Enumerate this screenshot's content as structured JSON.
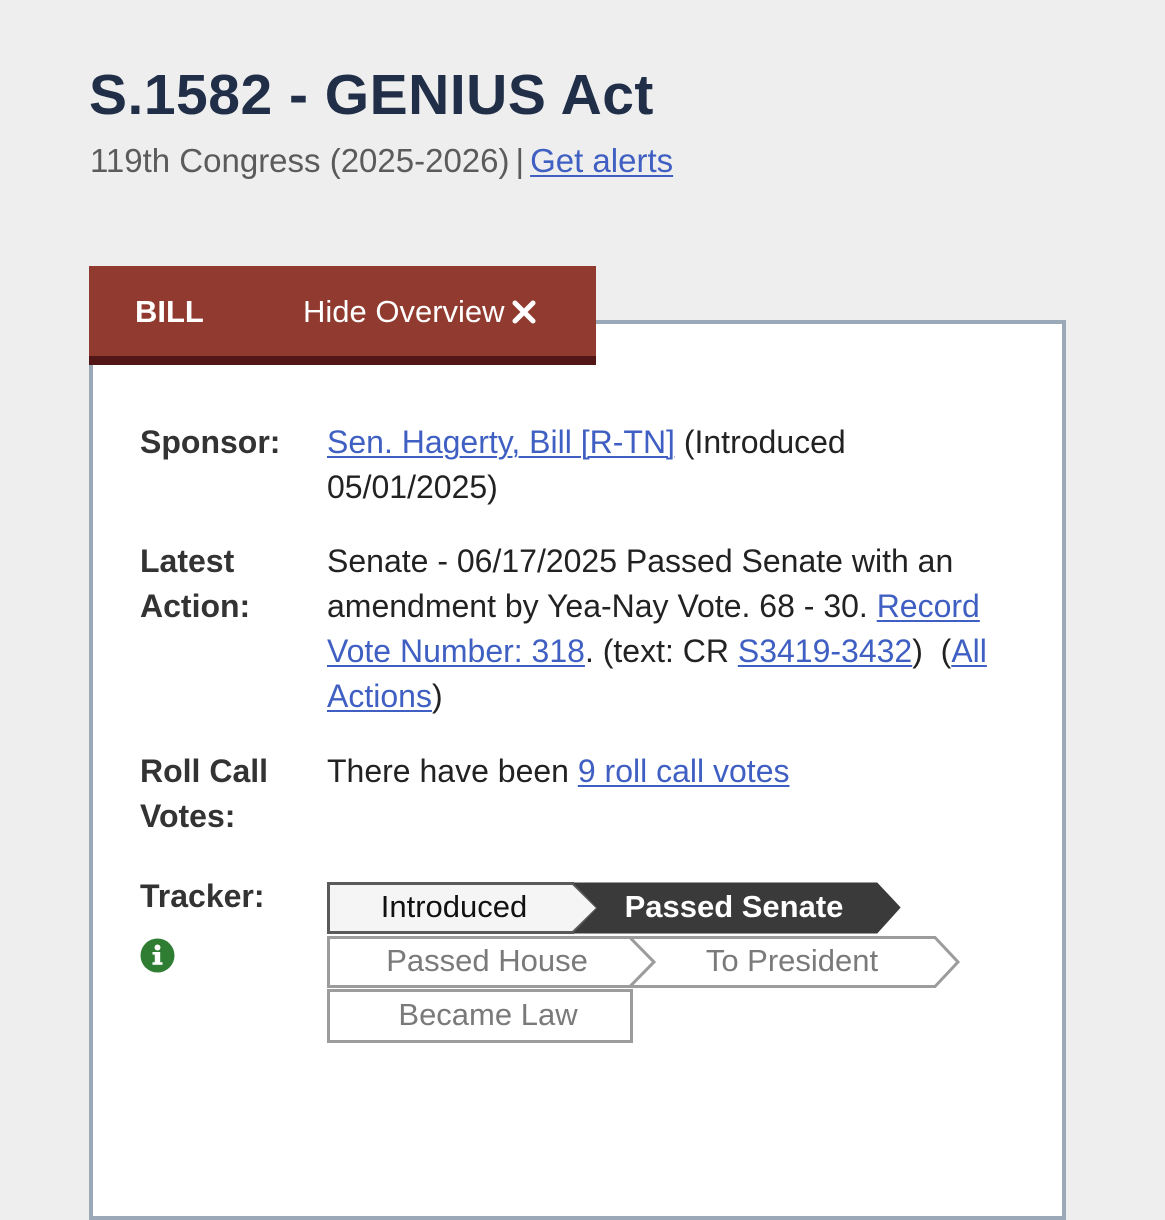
{
  "header": {
    "title": "S.1582 - GENIUS Act",
    "congress": "119th Congress (2025-2026)",
    "separator": "|",
    "alerts_link": "Get alerts"
  },
  "tab": {
    "type": "BILL",
    "toggle_label": "Hide Overview",
    "close_icon": "close-icon"
  },
  "overview": {
    "sponsor": {
      "label": "Sponsor:",
      "link": "Sen. Hagerty, Bill [R-TN]",
      "introduced_prefix": " (Introduced",
      "introduced_date": "05/01/2025)"
    },
    "latest_action": {
      "label_line1": "Latest",
      "label_line2": "Action:",
      "text": "Senate - 06/17/2025 Passed Senate with an amendment by Yea-Nay Vote. 68 - 30. ",
      "record_vote_link": "Record Vote Number: 318",
      "text_cr_prefix": ". (text: CR ",
      "cr_link": "S3419-3432",
      "mid": ")  (",
      "all_actions_link": "All Actions",
      "end": ")"
    },
    "roll_call": {
      "label_line1": "Roll Call",
      "label_line2": "Votes:",
      "prefix": "There have been ",
      "link": "9 roll call votes"
    },
    "tracker": {
      "label": "Tracker:",
      "info_icon": "info-icon",
      "steps": [
        {
          "label": "Introduced",
          "status": "completed"
        },
        {
          "label": "Passed Senate",
          "status": "current"
        },
        {
          "label": "Passed House",
          "status": "pending"
        },
        {
          "label": "To President",
          "status": "pending"
        },
        {
          "label": "Became Law",
          "status": "pending"
        }
      ]
    }
  },
  "colors": {
    "title": "#212e48",
    "link": "#3f5fc2",
    "tab_bg": "#913b30",
    "tab_border": "#521616",
    "panel_border": "#9aa8b8",
    "tracker_current": "#3a3a3a",
    "info_green": "#2e7d32"
  }
}
